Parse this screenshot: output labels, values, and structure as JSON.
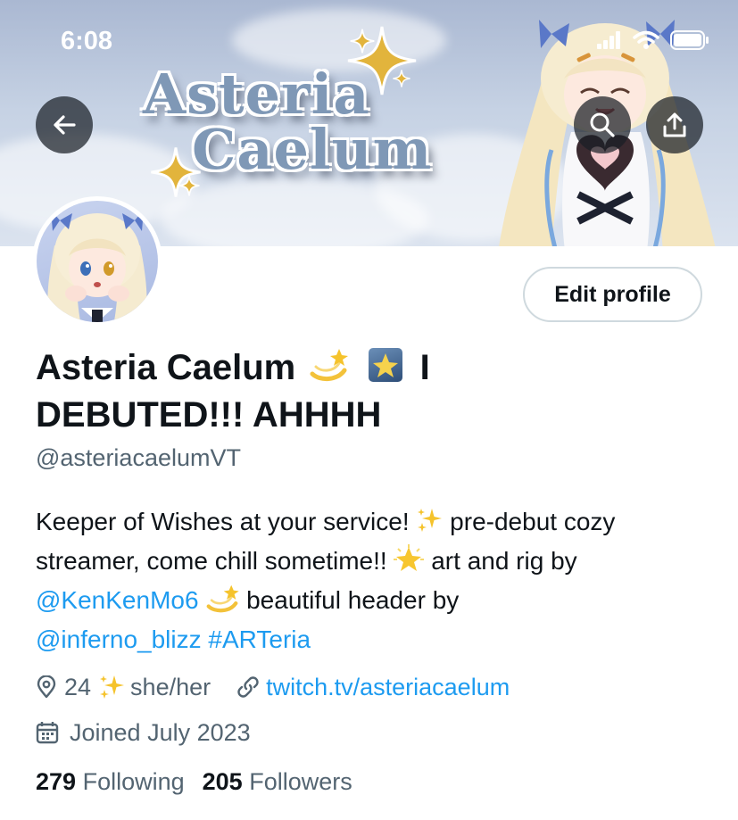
{
  "status_bar": {
    "time": "6:08"
  },
  "banner": {
    "title_line1": "Asteria",
    "title_line2": "Caelum"
  },
  "actions": {
    "edit_profile": "Edit profile"
  },
  "profile": {
    "name_part1": "Asteria Caelum",
    "name_part2": "I",
    "name_line2": "DEBUTED!!! AHHHH",
    "handle": "@asteriacaelumVT"
  },
  "bio": {
    "t1": "Keeper of Wishes at your service! ",
    "t2": " pre-debut cozy streamer, come chill sometime!! ",
    "t3": " art and rig by ",
    "mention1": "@KenKenMo6",
    "t4": " beautiful header by ",
    "mention2": "@inferno_blizz",
    "hashtag": "#ARTeria"
  },
  "meta": {
    "location_a": "24",
    "location_b": "she/her",
    "website": "twitch.tv/asteriacaelum",
    "joined": "Joined July 2023"
  },
  "stats": {
    "following_count": "279",
    "following_label": "Following",
    "followers_count": "205",
    "followers_label": "Followers"
  },
  "colors": {
    "link": "#1d9bf0",
    "secondary_text": "#536471",
    "primary_text": "#0f1419"
  }
}
